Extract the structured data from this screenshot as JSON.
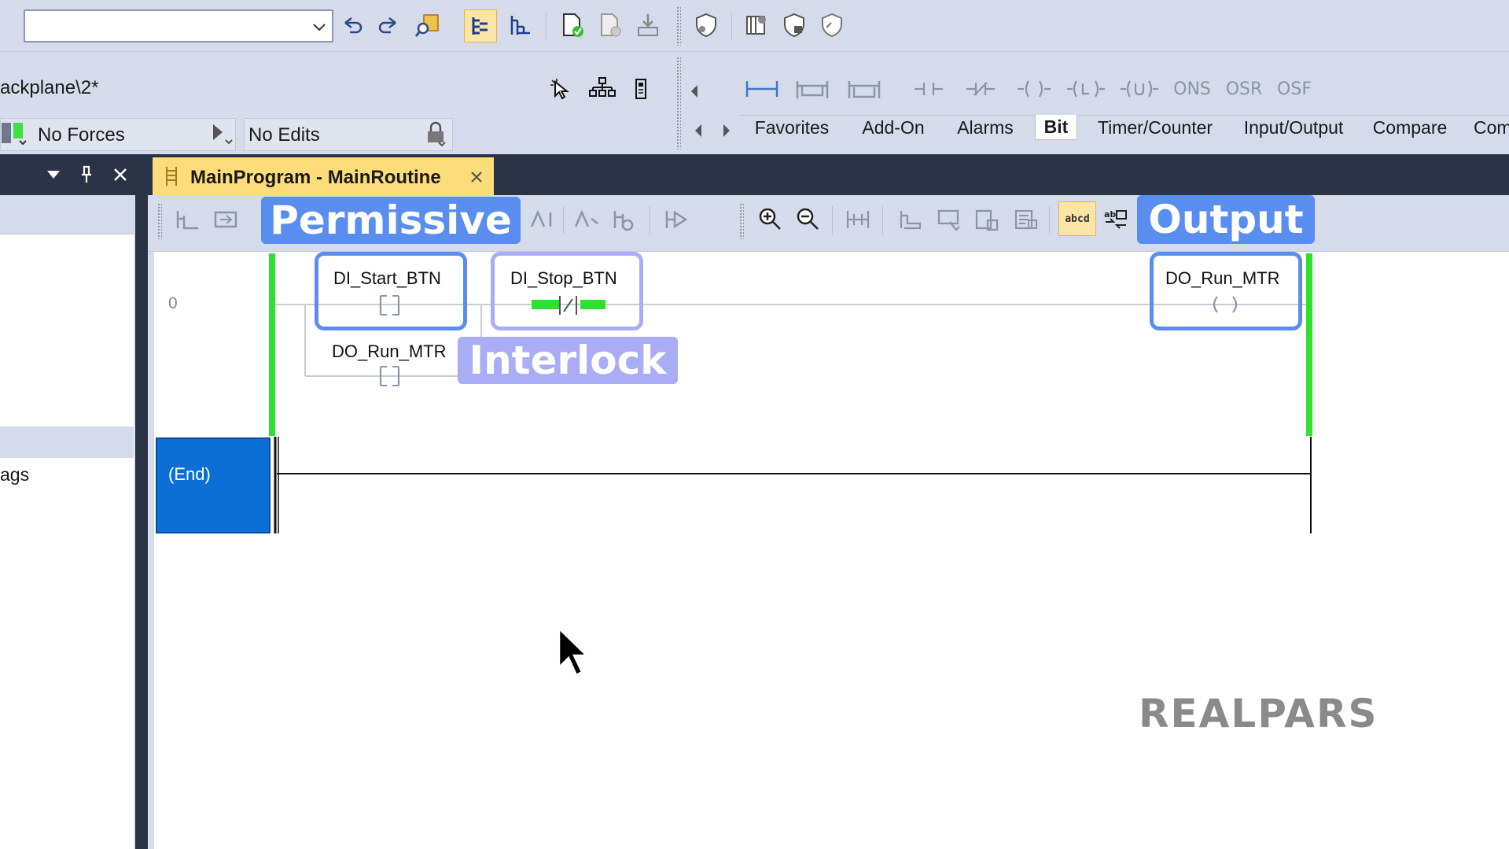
{
  "toolbar": {
    "path_text": "ackplane\\2*",
    "forces_text": "No Forces",
    "edits_text": "No Edits",
    "instructions": [
      "ONS",
      "OSR",
      "OSF"
    ],
    "instruction_tabs": [
      "Favorites",
      "Add-On",
      "Alarms",
      "Bit",
      "Timer/Counter",
      "Input/Output",
      "Compare",
      "Com"
    ],
    "active_tab": "Bit",
    "editor_tab_title": "MainProgram - MainRoutine"
  },
  "left_panel": {
    "item_text": "ags"
  },
  "ladder": {
    "rung0_number": "0",
    "start_contact_tag": "DI_Start_BTN",
    "seal_contact_tag": "DO_Run_MTR",
    "stop_contact_tag": "DI_Stop_BTN",
    "output_coil_tag": "DO_Run_MTR",
    "end_label": "(End)"
  },
  "annotations": {
    "permissive": "Permissive",
    "interlock": "Interlock",
    "output": "Output"
  },
  "watermark": "REALPARS",
  "colors": {
    "accent_blue": "#5a8df0",
    "interlock_purple": "#a8adf5",
    "power_green": "#2fe02f",
    "end_block": "#0b6fd6",
    "tab_active": "#fddc7a",
    "dark_header": "#2b3447"
  }
}
